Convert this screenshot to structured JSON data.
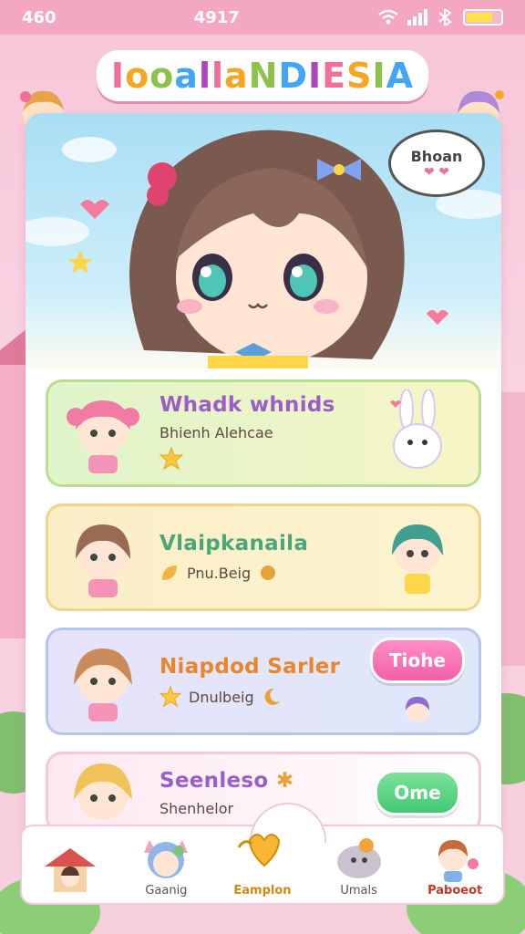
{
  "status_bar": {
    "time_left": "460",
    "time_center": "4917"
  },
  "header": {
    "title": "IooallaNDIESIA"
  },
  "hero": {
    "speech_text": "Bhoan",
    "speech_hearts": "❤ ❤"
  },
  "list": [
    {
      "title": "Whadk whnids",
      "subtitle": "Bhienh Alehcae",
      "sub_icon": "star-icon"
    },
    {
      "title": "Vlaipkanaila",
      "subtitle": "Pnu.Beig",
      "sub_icon": "leaf-icon"
    },
    {
      "title": "Niapdod Sarler",
      "subtitle": "Dnulbeig",
      "button": "Tiohe",
      "sub_icon": "star-icon"
    },
    {
      "title": "Seenleso",
      "subtitle": "Shenhelor",
      "button": "Ome"
    }
  ],
  "nav": [
    {
      "label": ""
    },
    {
      "label": "Gaanig"
    },
    {
      "label": "Eamplon"
    },
    {
      "label": "Umals"
    },
    {
      "label": "Paboeot"
    }
  ],
  "colors": {
    "accent_pink": "#f06e9a",
    "accent_green": "#43c774",
    "nav_active": "#d38a12"
  }
}
